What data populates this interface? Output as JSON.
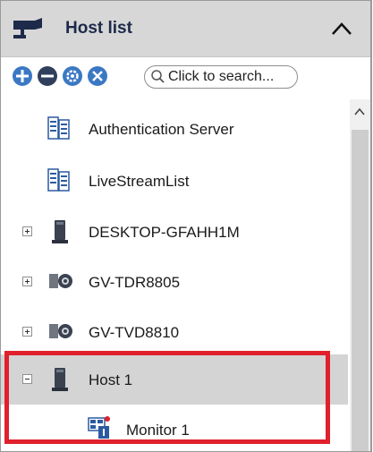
{
  "panel": {
    "title": "Host list",
    "collapse_icon": "chevron-up-icon"
  },
  "toolbar": {
    "buttons": [
      {
        "name": "add-host-button",
        "icon": "plus-circle-icon"
      },
      {
        "name": "remove-host-button",
        "icon": "minus-circle-icon"
      },
      {
        "name": "settings-button",
        "icon": "gear-icon"
      },
      {
        "name": "tools-button",
        "icon": "tools-icon"
      }
    ],
    "search_placeholder": "Click to search..."
  },
  "tree": {
    "items": [
      {
        "label": "Authentication Server",
        "icon": "server-icon",
        "expandable": false,
        "selected": false
      },
      {
        "label": "LiveStreamList",
        "icon": "server-icon",
        "expandable": false,
        "selected": false
      },
      {
        "label": "DESKTOP-GFAHH1M",
        "icon": "computer-icon",
        "expandable": true,
        "expanded": false,
        "selected": false
      },
      {
        "label": "GV-TDR8805",
        "icon": "dvr-camera-icon",
        "expandable": true,
        "expanded": false,
        "selected": false
      },
      {
        "label": "GV-TVD8810",
        "icon": "dvr-camera-icon",
        "expandable": true,
        "expanded": false,
        "selected": false
      },
      {
        "label": "Host 1",
        "icon": "computer-icon",
        "expandable": true,
        "expanded": true,
        "selected": true
      },
      {
        "label": "Monitor 1",
        "icon": "monitor-icon",
        "expandable": false,
        "selected": false
      }
    ]
  },
  "colors": {
    "header_bg": "#d7d7d7",
    "selected_row_bg": "#d4d4d4",
    "highlight_border": "#e0202c",
    "toolbar_icon": "#3b78c4"
  }
}
